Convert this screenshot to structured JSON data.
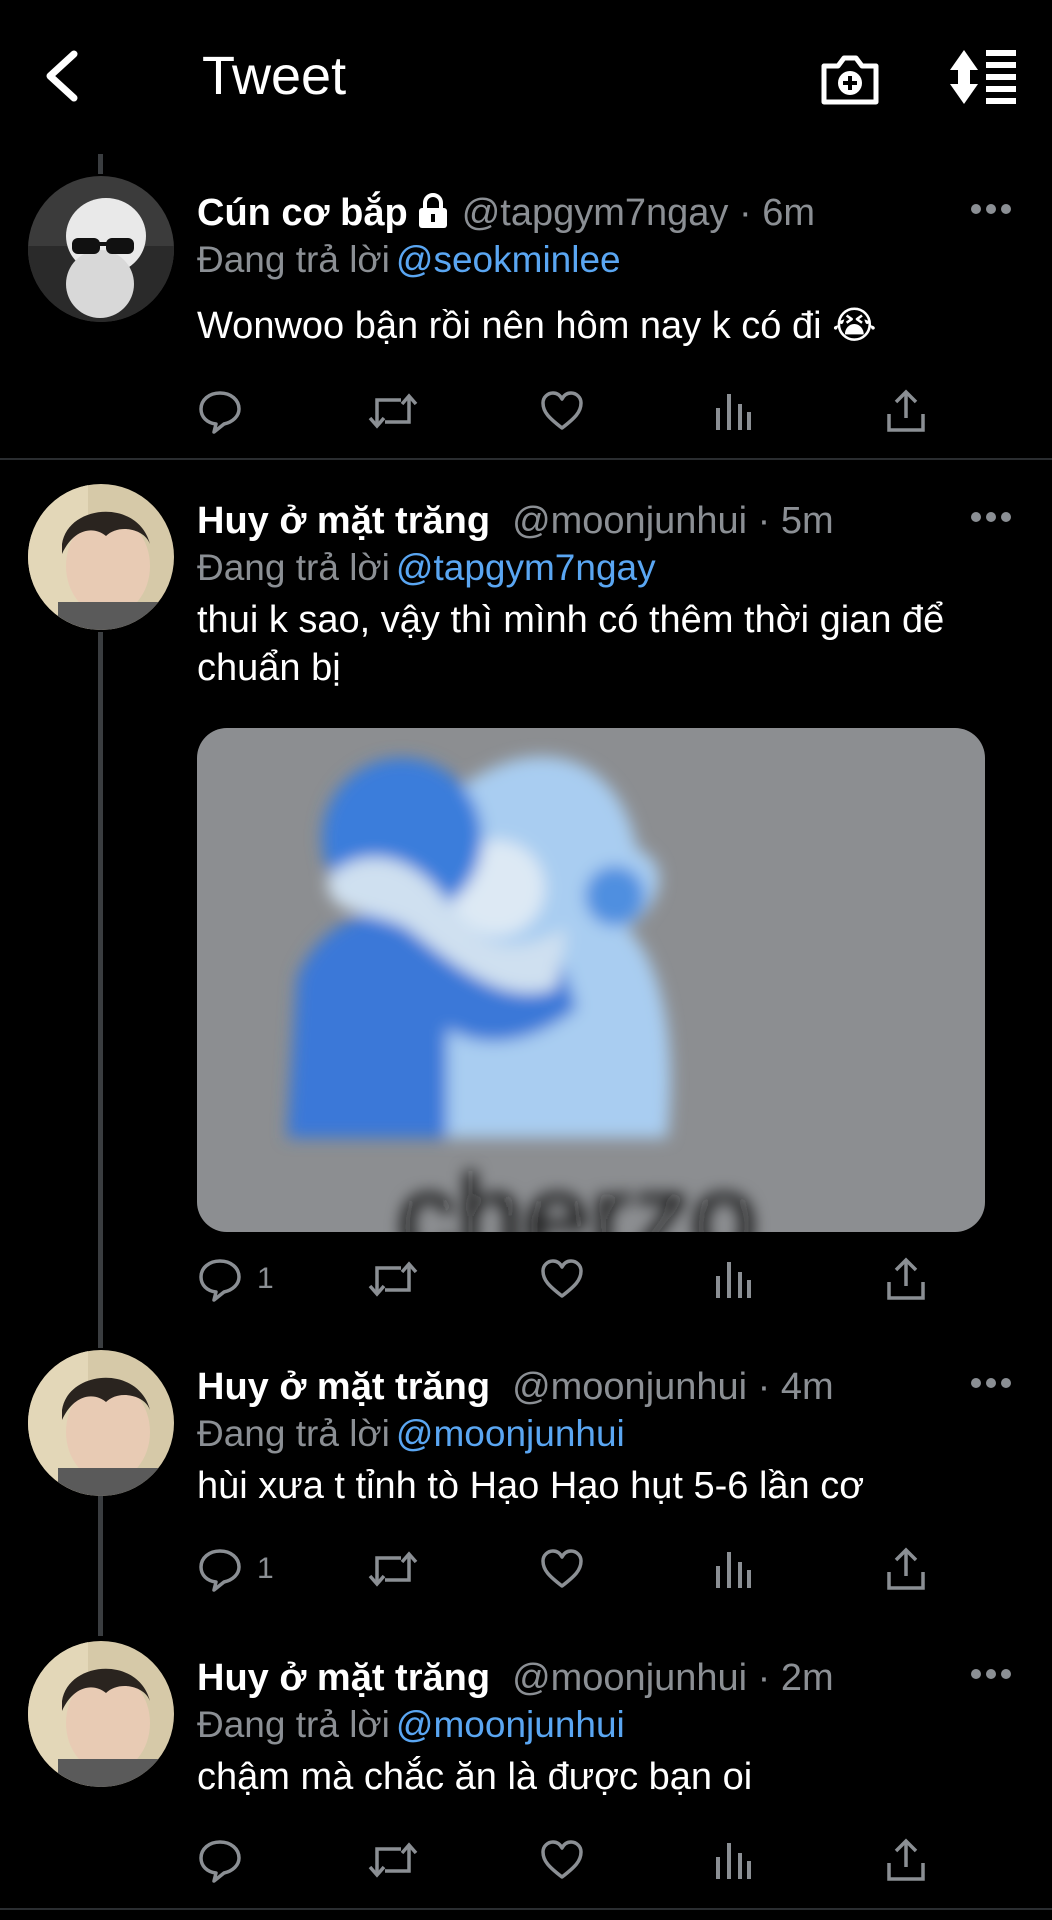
{
  "header": {
    "title": "Tweet",
    "back_icon": "chevron-left-icon",
    "camera_icon": "camera-add-icon",
    "sort_icon": "sort-list-icon"
  },
  "colors": {
    "background": "#000000",
    "mention": "#5aa6f2",
    "muted": "#8b8f94",
    "text": "#ffffff"
  },
  "tweets": [
    {
      "display_name": "Cún cơ bắp",
      "handle": "@tapgym7ngay · 6m",
      "protected": true,
      "reply_label": "Đang trả lời",
      "reply_to": "@seokminlee",
      "text": "Wonwoo bận rồi nên hôm nay k có đi 😭",
      "reply_count": ""
    },
    {
      "display_name": "Huy ở mặt trăng",
      "handle": "@moonjunhui · 5m",
      "reply_label": "Đang trả lời",
      "reply_to": "@tapgym7ngay",
      "text": "thui k sao, vậy thì mình có thêm thời gian để chuẩn bị",
      "reply_count": "1",
      "media": {
        "caption_fragment": "cherzo"
      }
    },
    {
      "display_name": "Huy ở mặt trăng",
      "handle": "@moonjunhui · 4m",
      "reply_label": "Đang trả lời",
      "reply_to": "@moonjunhui",
      "text": "hùi xưa t tỉnh tò Hạo Hạo hụt 5-6 lần cơ",
      "reply_count": "1"
    },
    {
      "display_name": "Huy ở mặt trăng",
      "handle": "@moonjunhui · 2m",
      "reply_label": "Đang trả lời",
      "reply_to": "@moonjunhui",
      "text": "chậm mà chắc ăn là được bạn oi",
      "reply_count": ""
    }
  ]
}
